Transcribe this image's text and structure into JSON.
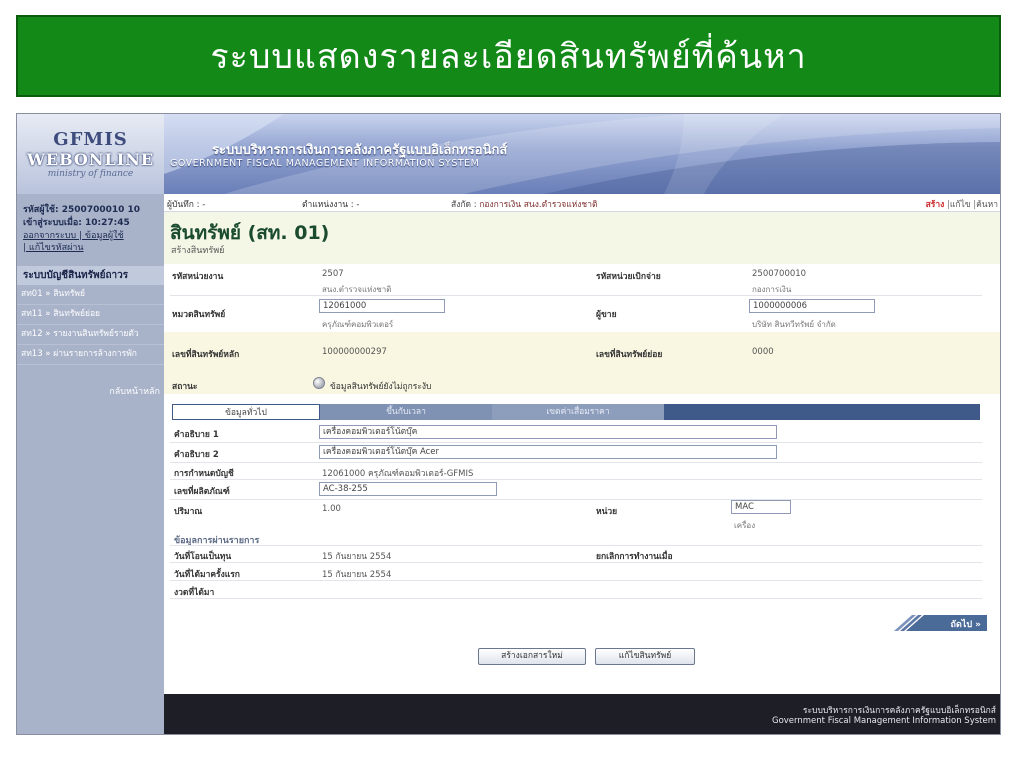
{
  "banner": {
    "title": "ระบบแสดงรายละเอียดสินทรัพย์ที่ค้นหา"
  },
  "header": {
    "logo_gfmis": "GFMIS",
    "logo_web": "WEBONLINE",
    "logo_ministry": "ministry of finance",
    "system_name_th": "ระบบบริหารการเงินการคลังภาครัฐแบบอิเล็กทรอนิกส์",
    "system_name_en": "GOVERNMENT FISCAL MANAGEMENT INFORMATION SYSTEM"
  },
  "sidebar": {
    "user_label": "รหัสผู้ใช้: 2500700010 10",
    "login_label": "เข้าสู่ระบบเมื่อ: 10:27:45",
    "logout_link": "ออกจากระบบ | ข้อมูลผู้ใช้",
    "change_pw_link": "| แก้ไขรหัสผ่าน",
    "section_title": "ระบบบัญชีสินทรัพย์ถาวร",
    "items": [
      {
        "label": "สท01 » สินทรัพย์"
      },
      {
        "label": "สท11 » สินทรัพย์ย่อย"
      },
      {
        "label": "สท12 » รายงานสินทรัพย์รายตัว"
      },
      {
        "label": "สท13 » ผ่านรายการล้างการพัก"
      }
    ],
    "back_label": "กลับหน้าหลัก"
  },
  "infobar": {
    "recorder": "ผู้บันทึก : -",
    "dept": "ตำแหน่งงาน : -",
    "under_label": "สังกัด :",
    "under_value": "กองการเงิน สนง.ตำรวจแห่งชาติ",
    "action_create": "สร้าง",
    "action_edit": "แก้ไข",
    "action_search": "ค้นหา",
    "sep": "|"
  },
  "page": {
    "title": "สินทรัพย์ (สท. 01)",
    "subtitle": "สร้างสินทรัพย์"
  },
  "form": {
    "unit_code_label": "รหัสหน่วยงาน",
    "unit_code": "2507",
    "unit_name": "สนง.ตำรวจแห่งชาติ",
    "disb_code_label": "รหัสหน่วยเบิกจ่าย",
    "disb_code": "2500700010",
    "disb_name": "กองการเงิน",
    "category_label": "หมวดสินทรัพย์",
    "category_code": "12061000",
    "category_name": "ครุภัณฑ์คอมพิวเตอร์",
    "vendor_label": "ผู้ขาย",
    "vendor_code": "1000000006",
    "vendor_name": "บริษัท สินทวีทรัพย์ จำกัด",
    "main_no_label": "เลขที่สินทรัพย์หลัก",
    "main_no": "100000000297",
    "sub_no_label": "เลขที่สินทรัพย์ย่อย",
    "sub_no": "0000",
    "status_label": "สถานะ",
    "status_value": "ข้อมูลสินทรัพย์ยังไม่ถูกระงับ"
  },
  "tabs": {
    "general": "ข้อมูลทั่วไป",
    "depreciation": "ขึ้นกับเวลา",
    "depr_value": "เขตค่าเสื่อมราคา"
  },
  "general": {
    "desc1_label": "คำอธิบาย 1",
    "desc1": "เครื่องคอมพิวเตอร์โน้ตบุ๊ค",
    "desc2_label": "คำอธิบาย 2",
    "desc2": "เครื่องคอมพิวเตอร์โน้ตบุ๊ค Acer",
    "account_label": "การกำหนดบัญชี",
    "account": "12061000 ครุภัณฑ์คอมพิวเตอร์-GFMIS",
    "product_no_label": "เลขที่ผลิตภัณฑ์",
    "product_no": "AC-38-255",
    "qty_label": "ปริมาณ",
    "qty": "1.00",
    "unit_label": "หน่วย",
    "unit_code": "MAC",
    "unit_name": "เครื่อง"
  },
  "posting": {
    "section_title": "ข้อมูลการผ่านรายการ",
    "capitalize_label": "วันที่โอนเป็นทุน",
    "capitalize_date": "15 กันยายน 2554",
    "deactivate_label": "ยกเลิกการทำงานเมื่อ",
    "first_acq_label": "วันที่ได้มาครั้งแรก",
    "first_acq_date": "15 กันยายน 2554",
    "period_label": "งวดที่ได้มา"
  },
  "buttons": {
    "next": "ถัดไป »",
    "new_doc": "สร้างเอกสารใหม่",
    "edit_asset": "แก้ไขสินทรัพย์"
  },
  "footer": {
    "line_th": "ระบบบริหารการเงินการคลังภาครัฐแบบอิเล็กทรอนิกส์",
    "line_en": "Government Fiscal Management Information System"
  }
}
